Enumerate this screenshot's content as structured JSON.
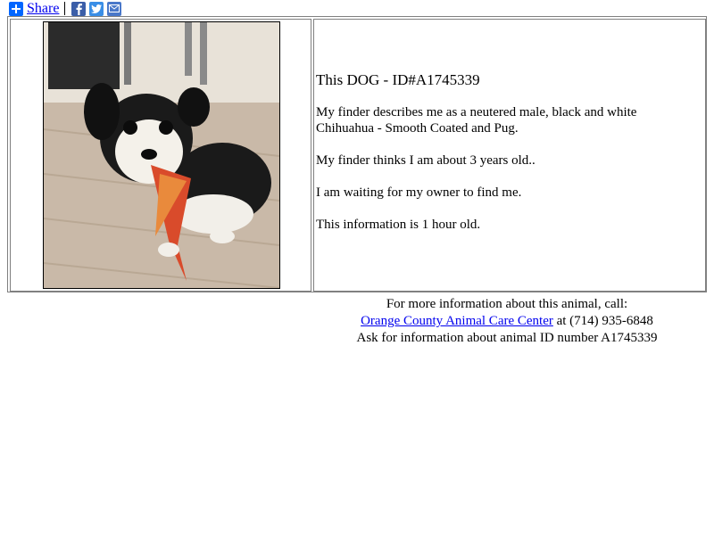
{
  "share": {
    "label": "Share",
    "icons": [
      "plus-icon",
      "facebook-icon",
      "twitter-icon",
      "email-icon"
    ]
  },
  "animal": {
    "title": "This DOG - ID#A1745339",
    "description": "My finder describes me as a neutered male, black and white Chihuahua - Smooth Coated and Pug.",
    "age": "My finder thinks I am about 3 years old..",
    "status": "I am waiting for my owner to find me.",
    "freshness": "This information is 1 hour old.",
    "photo": "dog-photo"
  },
  "contact": {
    "line1": "For more information about this animal, call:",
    "center_name": "Orange County Animal Care Center",
    "phone_text": " at (714) 935-6848",
    "line3": "Ask for information about animal ID number A1745339"
  },
  "colors": {
    "link": "#0000ee",
    "share_blue": "#0166ff",
    "border": "#808080"
  }
}
